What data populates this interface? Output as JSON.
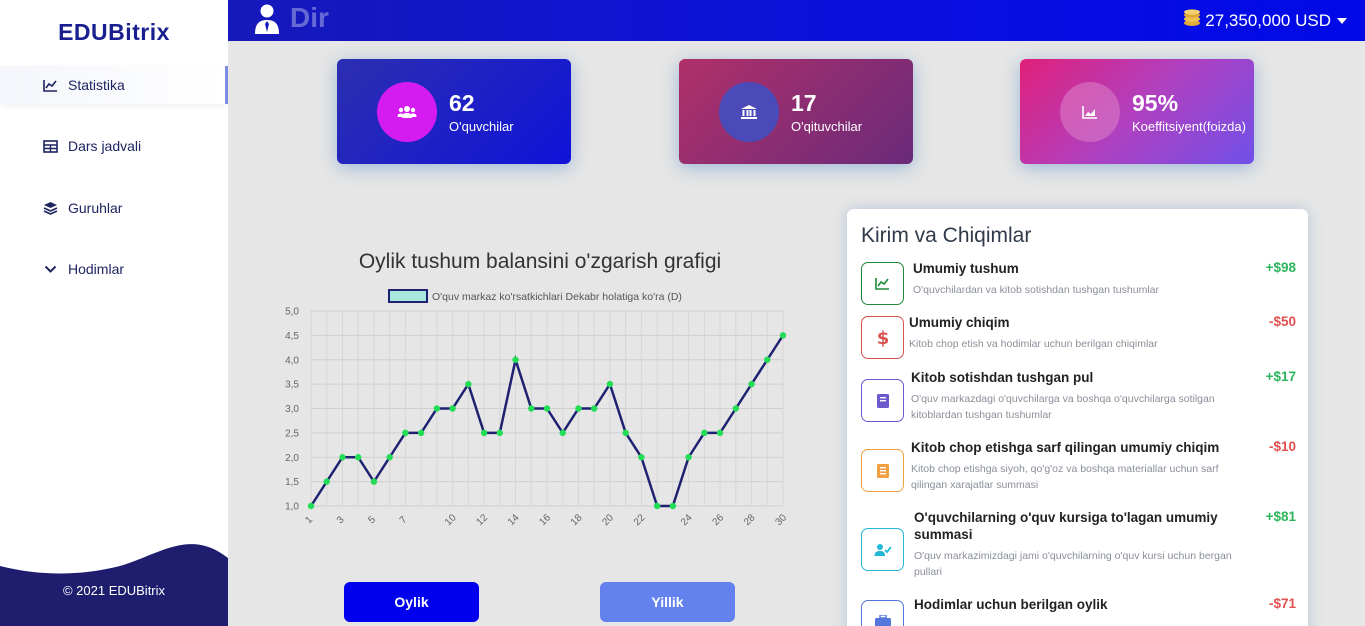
{
  "brand": "EDUBitrix",
  "sidebar": {
    "items": [
      {
        "label": "Statistika",
        "icon": "chart-line-icon"
      },
      {
        "label": "Dars jadvali",
        "icon": "table-icon"
      },
      {
        "label": "Guruhlar",
        "icon": "layers-icon"
      },
      {
        "label": "Hodimlar",
        "icon": "chevron-down-icon"
      }
    ],
    "footer": "© 2021 EDUBitrix"
  },
  "topbar": {
    "title": "Dir",
    "balance": "27,350,000 USD"
  },
  "stats": [
    {
      "value": "62",
      "label": "O'quvchilar",
      "icon": "users-icon"
    },
    {
      "value": "17",
      "label": "O'qituvchilar",
      "icon": "bank-icon"
    },
    {
      "value": "95%",
      "label": "Koeffitsiyent(foizda)",
      "icon": "chart-area-icon"
    }
  ],
  "chart_title": "Oylik tushum balansini o'zgarish grafigi",
  "chart_data": {
    "type": "line",
    "legend": "O'quv markaz ko'rsatkichlari Dekabr holatiga ko'ra (D)",
    "x": [
      1,
      2,
      3,
      4,
      5,
      6,
      7,
      8,
      9,
      10,
      11,
      12,
      13,
      14,
      15,
      16,
      17,
      18,
      19,
      20,
      21,
      22,
      23,
      24,
      25,
      26,
      27,
      28,
      29,
      30
    ],
    "x_tick_labels": [
      "1",
      "3",
      "5",
      "7",
      "10",
      "12",
      "14",
      "16",
      "18",
      "20",
      "22",
      "24",
      "26",
      "28",
      "30"
    ],
    "y_tick_labels": [
      "1,0",
      "1,5",
      "2,0",
      "2,5",
      "3,0",
      "3,5",
      "4,0",
      "4,5",
      "5,0"
    ],
    "series": [
      {
        "name": "O'quv markaz ko'rsatkichlari Dekabr holatiga ko'ra (D)",
        "values": [
          1,
          1.5,
          2,
          2,
          1.5,
          2,
          2.5,
          2.5,
          3,
          3,
          3.5,
          2.5,
          2.5,
          4,
          3,
          3,
          2.5,
          3,
          3,
          3.5,
          2.5,
          2,
          1,
          1,
          2,
          2.5,
          2.5,
          3,
          3.5,
          4,
          4.5
        ]
      }
    ],
    "ylim": [
      1,
      5
    ],
    "grid": true,
    "legend_position": "top",
    "line_color": "#1e2270",
    "point_color": "#22dd55"
  },
  "buttons": {
    "monthly": "Oylik",
    "yearly": "Yillik"
  },
  "transactions": {
    "title": "Kirim va Chiqimlar",
    "items": [
      {
        "name": "Umumiy tushum",
        "desc": "O'quvchilardan va kitob sotishdan tushgan tushumlar",
        "amount": "+$98",
        "icon": "chart-up-icon",
        "color": "#1f8a3a"
      },
      {
        "name": "Umumiy chiqim",
        "desc": "Kitob chop etish va hodimlar uchun berilgan chiqimlar",
        "amount": "-$50",
        "icon": "dollar-icon",
        "color": "#d9534f"
      },
      {
        "name": "Kitob sotishdan tushgan pul",
        "desc": "O'quv markazdagi o'quvchilarga va boshqa o'quvchilarga sotilgan kitoblardan tushgan tushumlar",
        "amount": "+$17",
        "icon": "book-icon",
        "color": "#6a5acd"
      },
      {
        "name": "Kitob chop etishga sarf qilingan umumiy chiqim",
        "desc": "Kitob chop etishga siyoh, qo'g'oz va boshqa materiallar uchun sarf qilingan xarajatlar summasi",
        "amount": "-$10",
        "icon": "notebook-icon",
        "color": "#f0a040"
      },
      {
        "name": "O'quvchilarning o'quv kursiga to'lagan umumiy summasi",
        "desc": "O'quv markazimizdagi jami o'quvchilarning o'quv kursi uchun bergan pullari",
        "amount": "+$81",
        "icon": "user-check-icon",
        "color": "#22b8d8"
      },
      {
        "name": "Hodimlar uchun berilgan oylik",
        "desc": "",
        "amount": "-$71",
        "icon": "briefcase-icon",
        "color": "#5577dd"
      }
    ]
  },
  "colors": {
    "positive": "#2db55d",
    "negative": "#e05050"
  }
}
